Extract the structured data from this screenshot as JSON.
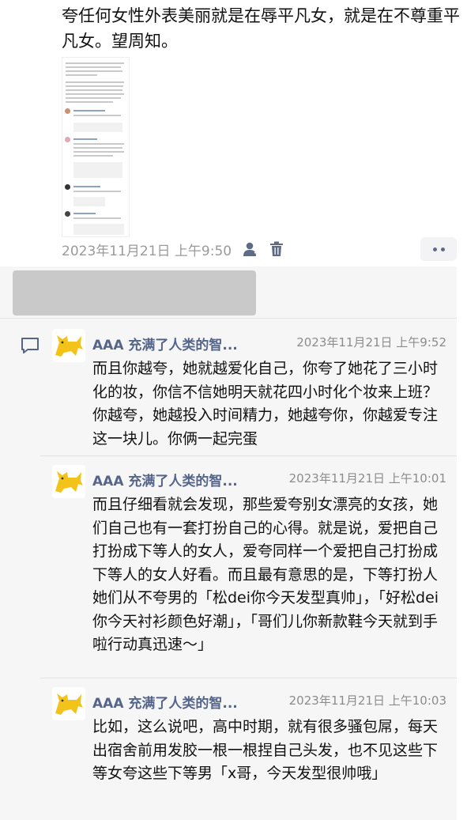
{
  "post": {
    "text": "夸任何女性外表美丽就是在辱平凡女，就是在不尊重平凡女。望周知。",
    "timestamp": "2023年11月21日 上午9:50"
  },
  "comments": [
    {
      "author": "AAA 充满了人类的智...",
      "time": "2023年11月21日 上午9:52",
      "text": "而且你越夸，她就越爱化自己，你夸了她花了三小时化的妆，你信不信她明天就花四小时化个妆来上班？你越夸，她越投入时间精力，她越夸你，你越爱专注这一块儿。你俩一起完蛋"
    },
    {
      "author": "AAA 充满了人类的智...",
      "time": "2023年11月21日 上午10:01",
      "text": "而且仔细看就会发现，那些爱夸别女漂亮的女孩，她们自己也有一套打扮自己的心得。就是说，爱把自己打扮成下等人的女人，爱夸同样一个爱把自己打扮成下等人的女人好看。而且最有意思的是，下等打扮人她们从不夸男的「松dei你今天发型真帅」，「好松dei你今天衬衫颜色好潮」，「哥们儿你新款鞋今天就到手啦行动真迅速～」"
    },
    {
      "author": "AAA 充满了人类的智...",
      "time": "2023年11月21日 上午10:03",
      "text": "比如，这么说吧，高中时期，就有很多骚包屌，每天出宿舍前用发胶一根一根捏自己头发，也不见这些下等女夸这些下等男「x哥，今天发型很帅哦」"
    }
  ],
  "icons": {
    "visibility": "person-icon",
    "delete": "trash-icon",
    "more": "more-dots-icon",
    "comment": "comment-icon",
    "avatar": "yellow-cat-avatar"
  },
  "colors": {
    "accent": "#55658a",
    "muted": "#9a9a9a",
    "panel": "#f6f6f6"
  }
}
